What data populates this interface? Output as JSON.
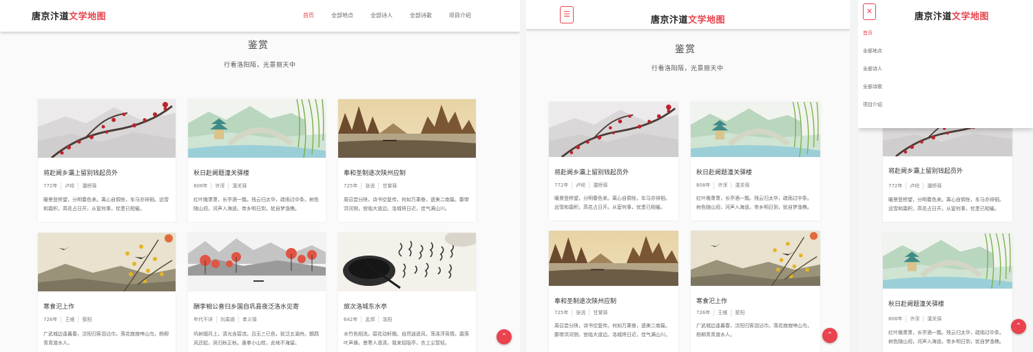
{
  "brand": {
    "main": "唐京汴道",
    "accent": "文学地图"
  },
  "nav": [
    "首页",
    "全部地点",
    "全部诗人",
    "全部诗歌",
    "项目介绍"
  ],
  "section": {
    "title": "鉴赏",
    "subtitle": "行看洛阳陌，光景丽天中"
  },
  "icons": {
    "menu": "☰",
    "close": "✕",
    "up": "⌃"
  },
  "colors": {
    "accent": "#e8434e",
    "text": "#333333",
    "muted": "#777777"
  },
  "poems": [
    {
      "title": "将赴阙乡灞上留别钱起员外",
      "year": "772年",
      "poet": "卢纶",
      "place": "灞桥驿",
      "excerpt": "暖景登桥望，分明春色来。离心自惆怅，车马亦徘徊。远雪和霜积，高花占日开。从宦何事，忧患已相催。",
      "image": "plum-blossom-painting"
    },
    {
      "title": "秋日赴阙题潼关驿楼",
      "year": "808年",
      "poet": "许浑",
      "place": "潼关驿",
      "excerpt": "红叶晚萧萧，长亭酒一瓢。残云归太华，疏雨过中条。树色随山迥，河声入海遥。帝乡明日到，犹自梦渔樵。",
      "image": "pavilion-bridge-painting"
    },
    {
      "title": "奉和圣制途次陕州应制",
      "year": "725年",
      "poet": "张说",
      "place": "甘棠驿",
      "excerpt": "周召尝分陕，诗书空复传。何如万乘眷，遗美二南篇。鄭带洪河侧，宫临大道边。洛城将日近，佳气满山川。",
      "image": "river-landscape-painting"
    },
    {
      "title": "寒食汜上作",
      "year": "726年",
      "poet": "王维",
      "place": "荥阳",
      "excerpt": "广武城边逢暮春，汶阳归客泪沾巾。落花寂寂啼山鸟，杨柳青青渡水人。",
      "image": "swallow-blossom-painting"
    },
    {
      "title": "酬李相公喜归乡国自巩县夜泛洛水见寄",
      "year": "年代不详",
      "poet": "刘禹锡",
      "place": "孝义驿",
      "excerpt": "巩树烟月上，清光含碧流。且无三已色，犹泛五湖舟。鹦鹉风还起，凤归秋正秋。愚拳小山桂，此地不淹留。",
      "image": "red-trees-mist-painting"
    },
    {
      "title": "旅次洛城东水亭",
      "year": "642年",
      "poet": "孟郊",
      "place": "洛阳",
      "excerpt": "水竹色相洗，碧花动轩楹。自然逍遥风，荡涤浮竞情。霜落叶声燥，景寒人语清。我来招隐亭，衣上尘暂轻。",
      "image": "ink-calligraphy-photo"
    }
  ]
}
